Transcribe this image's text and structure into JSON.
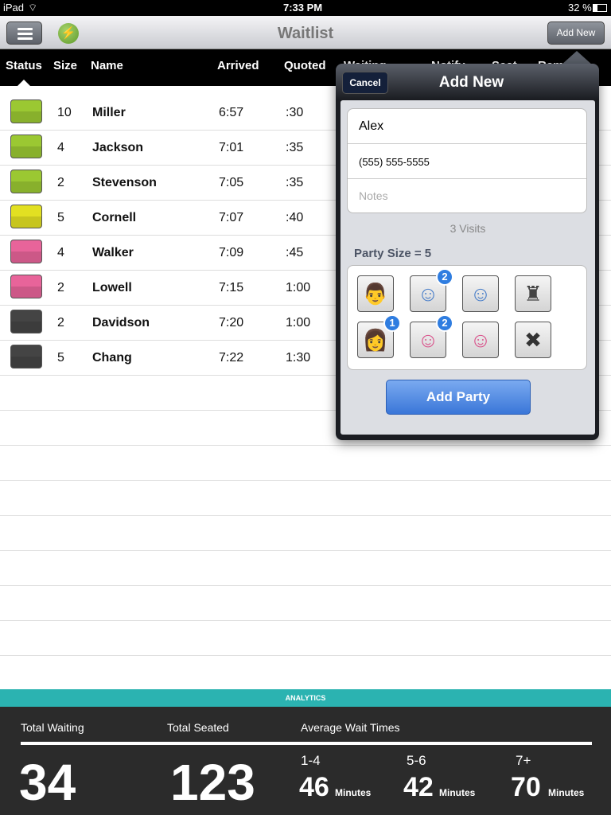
{
  "status_bar": {
    "device": "iPad",
    "time": "7:33 PM",
    "battery": "32 %"
  },
  "navbar": {
    "title": "Waitlist",
    "add_new": "Add New"
  },
  "columns": [
    "Status",
    "Size",
    "Name",
    "Arrived",
    "Quoted",
    "Waiting",
    "Notify",
    "Seat",
    "Rem"
  ],
  "rows": [
    {
      "color": "#9bc832",
      "size": "10",
      "name": "Miller",
      "arrived": "6:57",
      "quoted": ":30"
    },
    {
      "color": "#9bc832",
      "size": "4",
      "name": "Jackson",
      "arrived": "7:01",
      "quoted": ":35"
    },
    {
      "color": "#9bc832",
      "size": "2",
      "name": "Stevenson",
      "arrived": "7:05",
      "quoted": ":35"
    },
    {
      "color": "#e2e022",
      "size": "5",
      "name": "Cornell",
      "arrived": "7:07",
      "quoted": ":40"
    },
    {
      "color": "#e8649a",
      "size": "4",
      "name": "Walker",
      "arrived": "7:09",
      "quoted": ":45"
    },
    {
      "color": "#e8649a",
      "size": "2",
      "name": "Lowell",
      "arrived": "7:15",
      "quoted": "1:00"
    },
    {
      "color": "#444444",
      "size": "2",
      "name": "Davidson",
      "arrived": "7:20",
      "quoted": "1:00"
    },
    {
      "color": "#444444",
      "size": "5",
      "name": "Chang",
      "arrived": "7:22",
      "quoted": "1:30"
    }
  ],
  "popover": {
    "cancel": "Cancel",
    "title": "Add New",
    "name": "Alex",
    "phone": "(555) 555-5555",
    "notes_placeholder": "Notes",
    "visits": "3 Visits",
    "party_size": "Party Size = 5",
    "add_party": "Add Party",
    "guests": [
      {
        "icon": "man-glasses-icon",
        "color": "#4a7fc9",
        "badge": null
      },
      {
        "icon": "man-icon",
        "color": "#4a7fc9",
        "badge": "2"
      },
      {
        "icon": "boy-icon",
        "color": "#4a7fc9",
        "badge": null
      },
      {
        "icon": "darth-vader-icon",
        "color": "#444444",
        "badge": null
      },
      {
        "icon": "woman-glasses-icon",
        "color": "#d9508a",
        "badge": "1"
      },
      {
        "icon": "woman-icon",
        "color": "#d9508a",
        "badge": "2"
      },
      {
        "icon": "girl-icon",
        "color": "#d9508a",
        "badge": null
      },
      {
        "icon": "clear-x-icon",
        "color": "#333333",
        "badge": null
      }
    ]
  },
  "analytics": {
    "header": "ANALYTICS",
    "total_waiting_label": "Total Waiting",
    "total_waiting": "34",
    "total_seated_label": "Total Seated",
    "total_seated": "123",
    "avg_label": "Average Wait Times",
    "avg": [
      {
        "range": "1-4",
        "value": "46",
        "unit": "Minutes"
      },
      {
        "range": "5-6",
        "value": "42",
        "unit": "Minutes"
      },
      {
        "range": "7+",
        "value": "70",
        "unit": "Minutes"
      }
    ]
  }
}
